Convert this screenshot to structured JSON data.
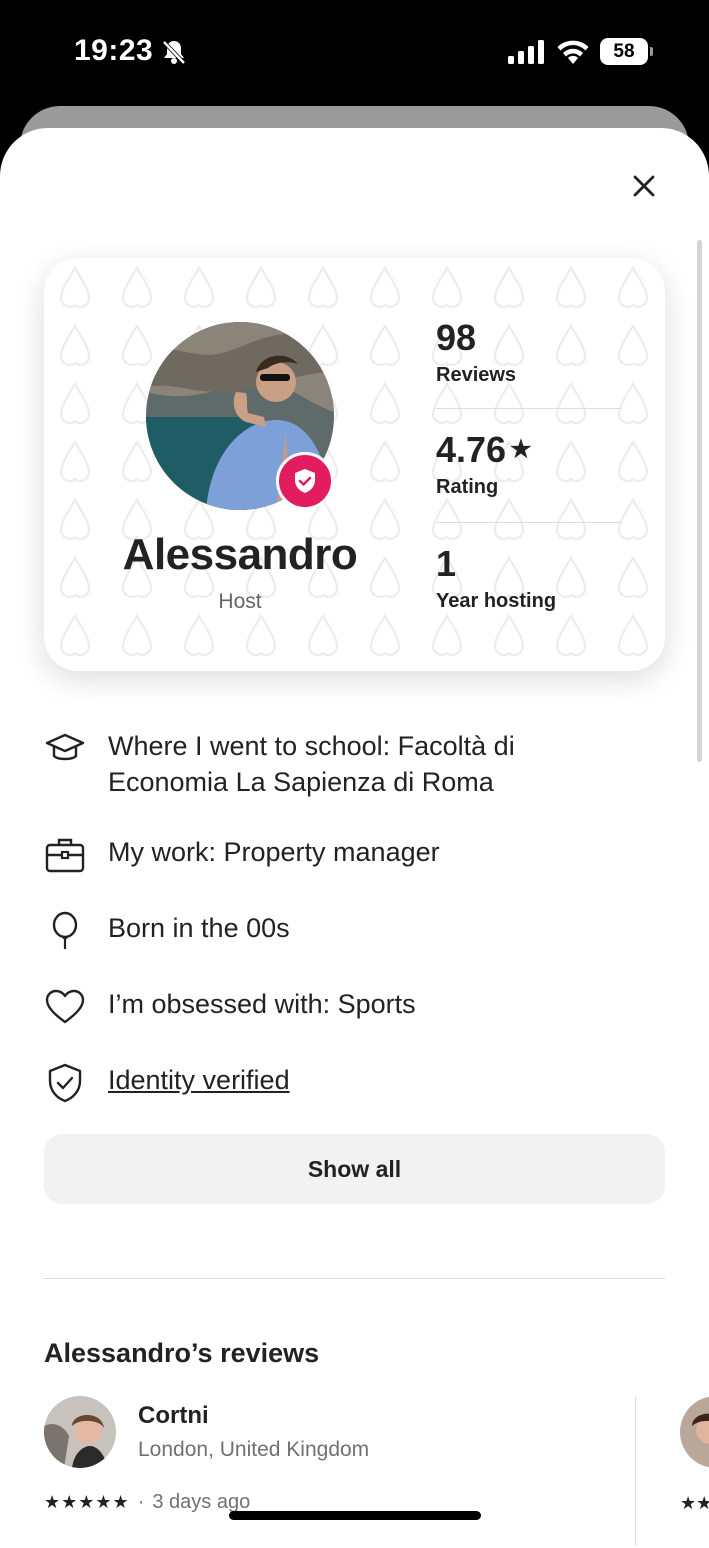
{
  "status_bar": {
    "time": "19:23",
    "battery": "58"
  },
  "host": {
    "name": "Alessandro",
    "role": "Host",
    "stats": [
      {
        "value": "98",
        "label": "Reviews"
      },
      {
        "value": "4.76",
        "label": "Rating",
        "star": "★"
      },
      {
        "value": "1",
        "label": "Year hosting"
      }
    ]
  },
  "facts": [
    {
      "icon": "graduation-cap-icon",
      "text": "Where I went to school: Facoltà di Economia La Sapienza di Roma"
    },
    {
      "icon": "briefcase-icon",
      "text": "My work: Property manager"
    },
    {
      "icon": "balloon-icon",
      "text": "Born in the 00s"
    },
    {
      "icon": "heart-icon",
      "text": "I’m obsessed with: Sports"
    },
    {
      "icon": "shield-check-icon",
      "text": "Identity verified"
    }
  ],
  "show_all_label": "Show all",
  "reviews": {
    "title": "Alessandro’s reviews",
    "items": [
      {
        "name": "Cortni",
        "location": "London, United Kingdom",
        "stars": "★★★★★",
        "separator": "·",
        "date": "3 days ago"
      }
    ],
    "peek_stars": "★★"
  },
  "colors": {
    "brand": "#e31c5f",
    "text": "#222222",
    "muted": "#717171"
  }
}
